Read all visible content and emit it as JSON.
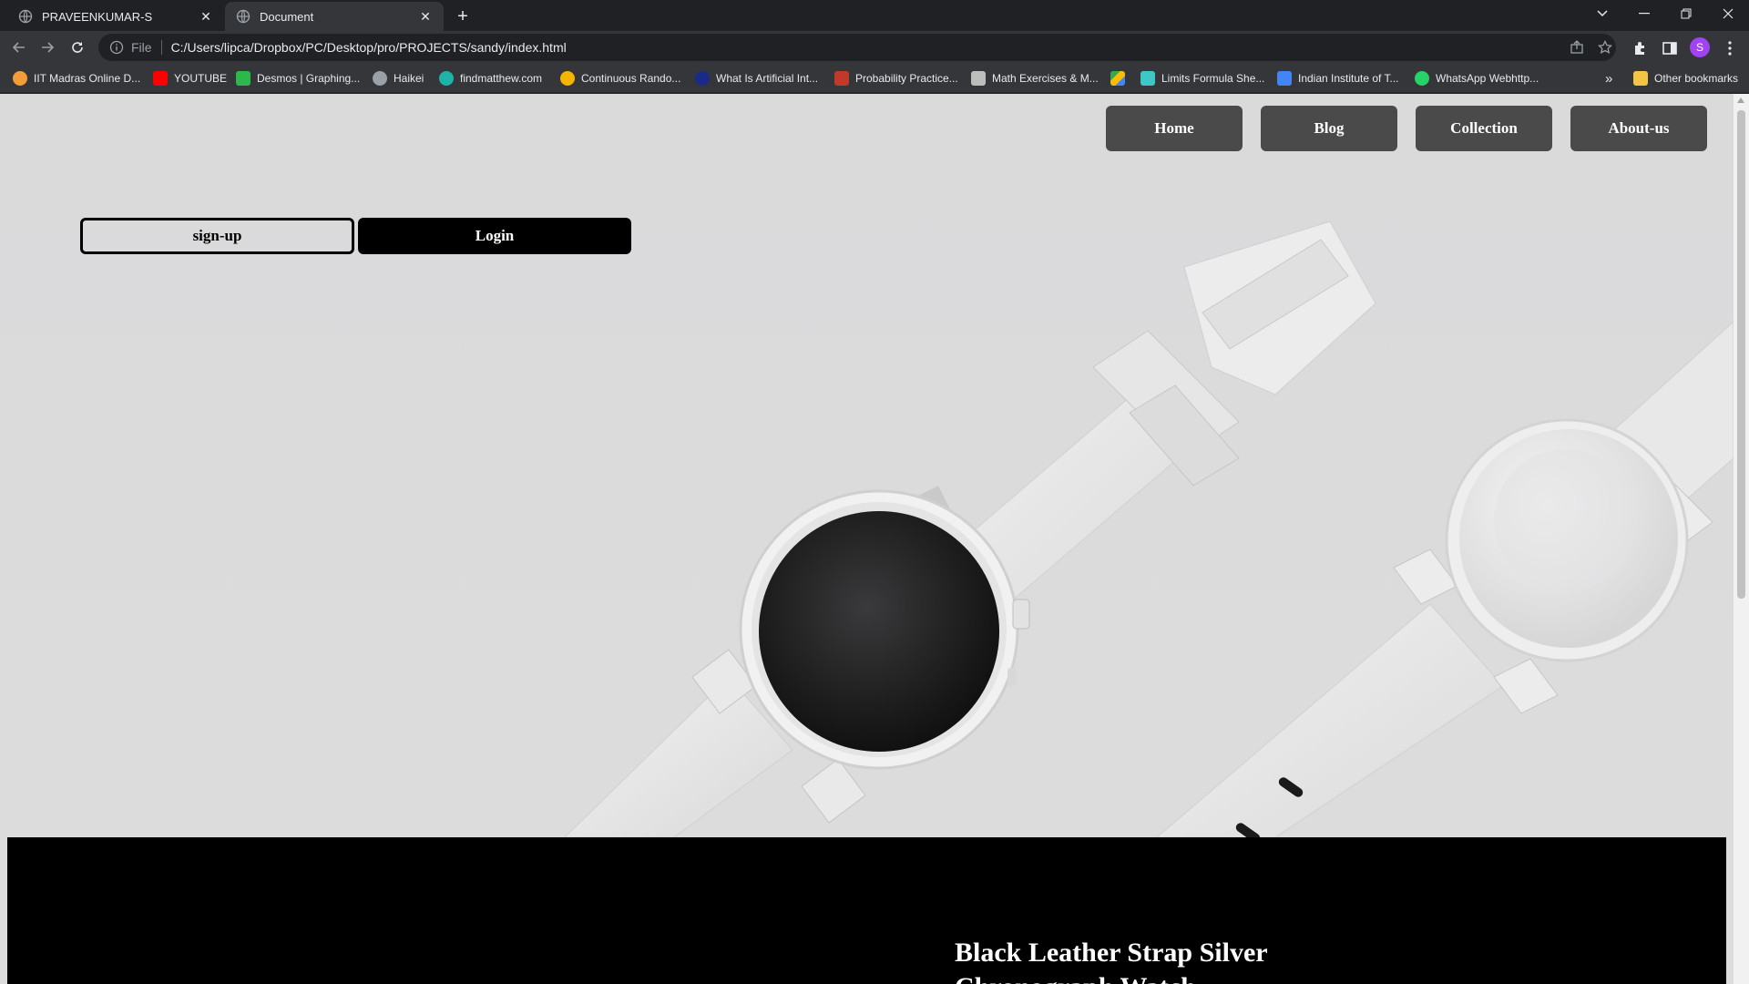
{
  "browser": {
    "tabs": [
      {
        "title": "PRAVEENKUMAR-S",
        "close": "✕"
      },
      {
        "title": "Document",
        "close": "✕"
      }
    ],
    "new_tab": "+",
    "scheme_label": "File",
    "url": "C:/Users/lipca/Dropbox/PC/Desktop/pro/PROJECTS/sandy/index.html",
    "profile_initial": "S",
    "bookmarks": [
      {
        "label": "IIT Madras Online D...",
        "color": "#f29d38"
      },
      {
        "label": "YOUTUBE",
        "color": "#ff0000"
      },
      {
        "label": "Desmos | Graphing...",
        "color": "#2db84b"
      },
      {
        "label": "Haikei",
        "color": "#9aa0a6"
      },
      {
        "label": "findmatthew.com",
        "color": "#1fb3a8"
      },
      {
        "label": "Continuous Rando...",
        "color": "#f4b400"
      },
      {
        "label": "What Is Artificial Int...",
        "color": "#1a2a8a"
      },
      {
        "label": "Probability Practice...",
        "color": "#c0392b"
      },
      {
        "label": "Math Exercises & M...",
        "color": "#bdbdbd"
      },
      {
        "label": "",
        "color": "#34a853"
      },
      {
        "label": "Limits Formula She...",
        "color": "#3fc6c6"
      },
      {
        "label": "Indian Institute of T...",
        "color": "#4285f4"
      },
      {
        "label": "WhatsApp Webhttp...",
        "color": "#25d366"
      }
    ],
    "more_bookmarks": "»",
    "other_bookmarks": "Other bookmarks"
  },
  "page": {
    "nav": [
      "Home",
      "Blog",
      "Collection",
      "About-us"
    ],
    "signup_label": "sign-up",
    "login_label": "Login",
    "product_title": "Black Leather Strap Silver Chronograph Watch"
  }
}
